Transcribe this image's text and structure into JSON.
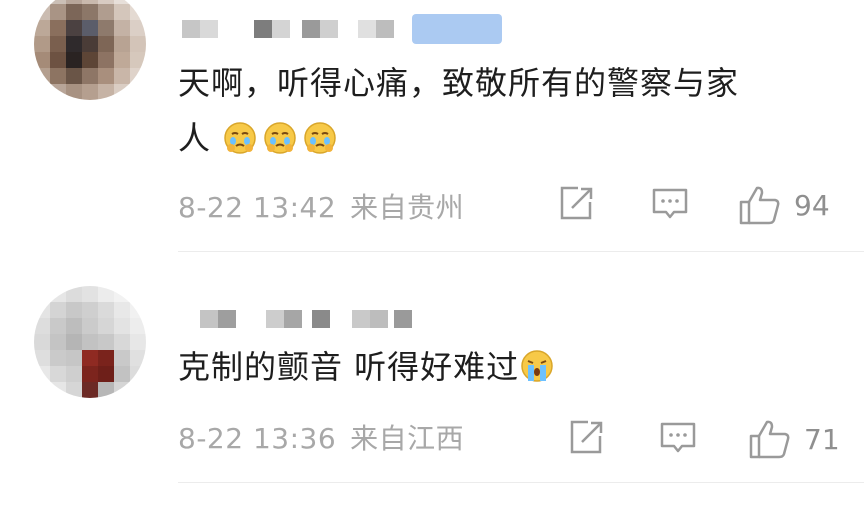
{
  "comments": [
    {
      "text_line1": "天啊，听得心痛，致敬所有的警察与家",
      "text_line2": "人",
      "emojis": [
        "crying-face",
        "crying-face",
        "crying-face"
      ],
      "date": "8-22 13:42",
      "location": "来自贵州",
      "likes": "94"
    },
    {
      "text": "克制的颤音  听得好难过",
      "emojis": [
        "sobbing-face"
      ],
      "date": "8-22 13:36",
      "location": "来自江西",
      "likes": "71"
    }
  ],
  "colors": {
    "meta_text": "#a8a8a8",
    "badge": "#9cc1f0",
    "divider": "#ececec"
  }
}
